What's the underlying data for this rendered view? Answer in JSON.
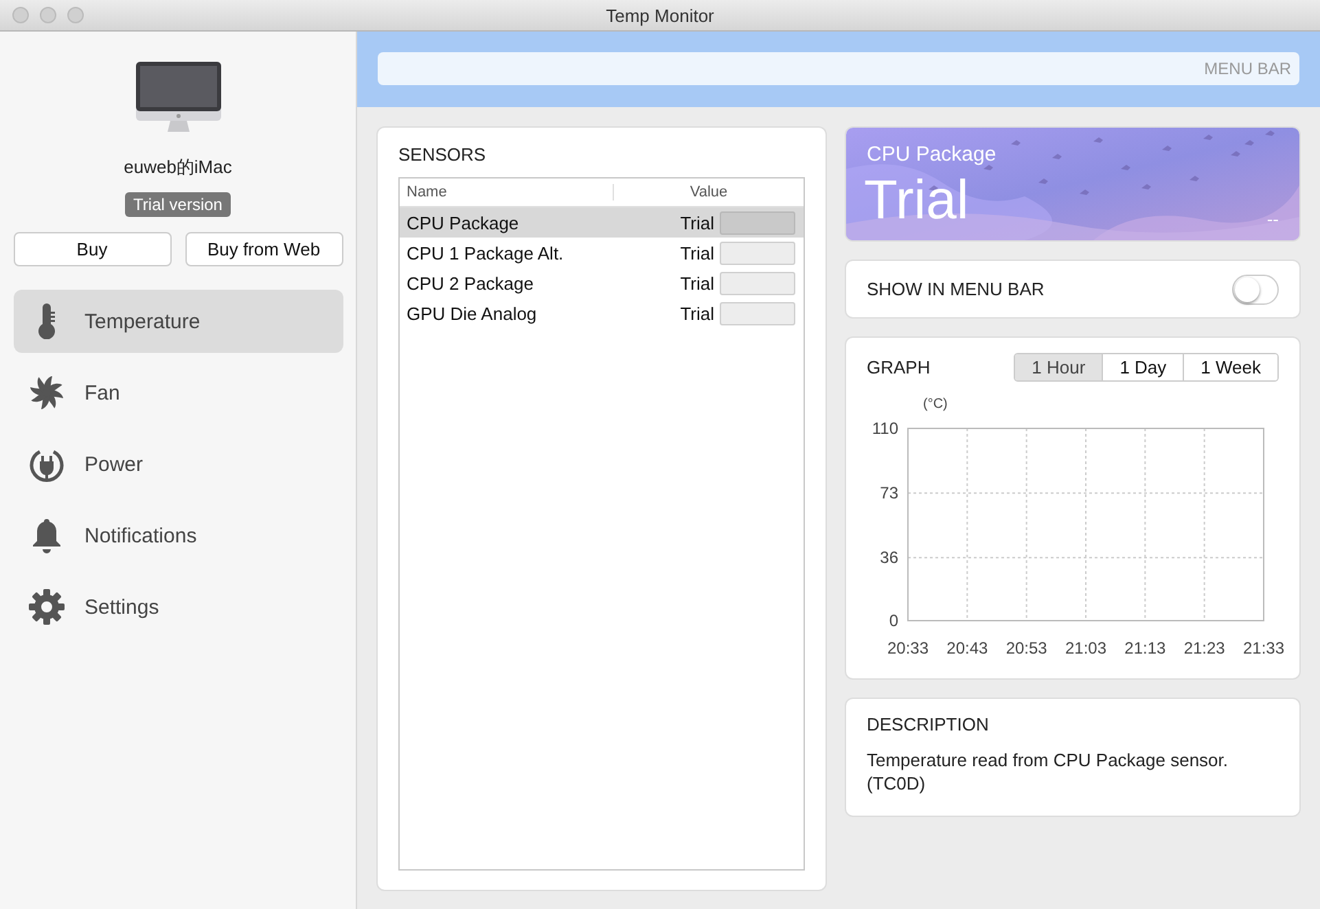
{
  "window": {
    "title": "Temp Monitor"
  },
  "device": {
    "name": "euweb的iMac",
    "badge": "Trial version"
  },
  "buttons": [
    {
      "label": "Buy"
    },
    {
      "label": "Buy from Web"
    }
  ],
  "sidebar": {
    "items": [
      {
        "label": "Temperature",
        "kind": "thermometer",
        "selected": true
      },
      {
        "label": "Fan",
        "kind": "fan",
        "selected": false
      },
      {
        "label": "Power",
        "kind": "power",
        "selected": false
      },
      {
        "label": "Notifications",
        "kind": "bell",
        "selected": false
      },
      {
        "label": "Settings",
        "kind": "gear",
        "selected": false
      }
    ]
  },
  "menu_bar_preview": {
    "label": "MENU BAR"
  },
  "sensors": {
    "title": "SENSORS",
    "columns": [
      "Name",
      "Value"
    ],
    "rows": [
      {
        "name": "CPU Package",
        "value": "Trial",
        "selected": true
      },
      {
        "name": "CPU 1 Package Alt.",
        "value": "Trial",
        "selected": false
      },
      {
        "name": "CPU 2 Package",
        "value": "Trial",
        "selected": false
      },
      {
        "name": "GPU Die Analog",
        "value": "Trial",
        "selected": false
      }
    ]
  },
  "current": {
    "sensor": "CPU Package",
    "value": "Trial",
    "unit": "--"
  },
  "show_in_menu_bar": {
    "label": "SHOW IN MENU BAR",
    "on": false
  },
  "graph": {
    "title": "GRAPH",
    "ranges": [
      {
        "label": "1 Hour",
        "selected": true
      },
      {
        "label": "1 Day",
        "selected": false
      },
      {
        "label": "1 Week",
        "selected": false
      }
    ],
    "chart_data": {
      "type": "line",
      "ylabel": "(°C)",
      "categories": [
        "20:33",
        "20:43",
        "20:53",
        "21:03",
        "21:13",
        "21:23",
        "21:33"
      ],
      "ylim": [
        0,
        110
      ],
      "grid": true,
      "yticks": [
        0,
        36,
        73,
        110
      ]
    }
  },
  "description": {
    "title": "DESCRIPTION",
    "text": "Temperature read from CPU Package sensor. (TC0D)"
  }
}
